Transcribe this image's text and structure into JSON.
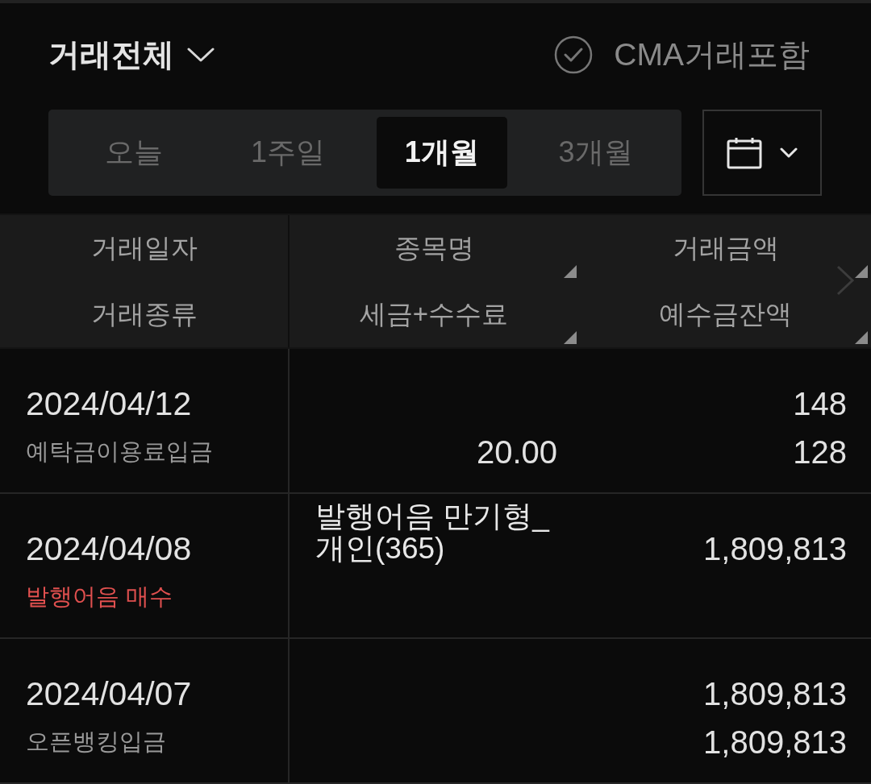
{
  "filter": {
    "label": "거래전체"
  },
  "cma_option": {
    "label": "CMA거래포함",
    "checked": false
  },
  "period_tabs": [
    {
      "label": "오늘",
      "selected": false
    },
    {
      "label": "1주일",
      "selected": false
    },
    {
      "label": "1개월",
      "selected": true
    },
    {
      "label": "3개월",
      "selected": false
    }
  ],
  "table": {
    "columns": [
      {
        "labels": [
          "거래일자",
          "거래종류"
        ],
        "sortable": false
      },
      {
        "labels": [
          "종목명",
          "세금+수수료"
        ],
        "sortable": true
      },
      {
        "labels": [
          "거래금액",
          "예수금잔액"
        ],
        "sortable": true
      }
    ],
    "rows": [
      {
        "date": "2024/04/12",
        "type": "예탁금이용료입금",
        "kind": "deposit",
        "fee": "20.00",
        "amount": "148",
        "balance": "128"
      },
      {
        "date": "2024/04/08",
        "type": "발행어음 매수",
        "kind": "buy",
        "name": "발행어음 만기형_개인(365)",
        "amount": "1,809,813"
      },
      {
        "date": "2024/04/07",
        "type": "오픈뱅킹입금",
        "kind": "deposit",
        "amount": "1,809,813",
        "balance": "1,809,813"
      }
    ]
  }
}
